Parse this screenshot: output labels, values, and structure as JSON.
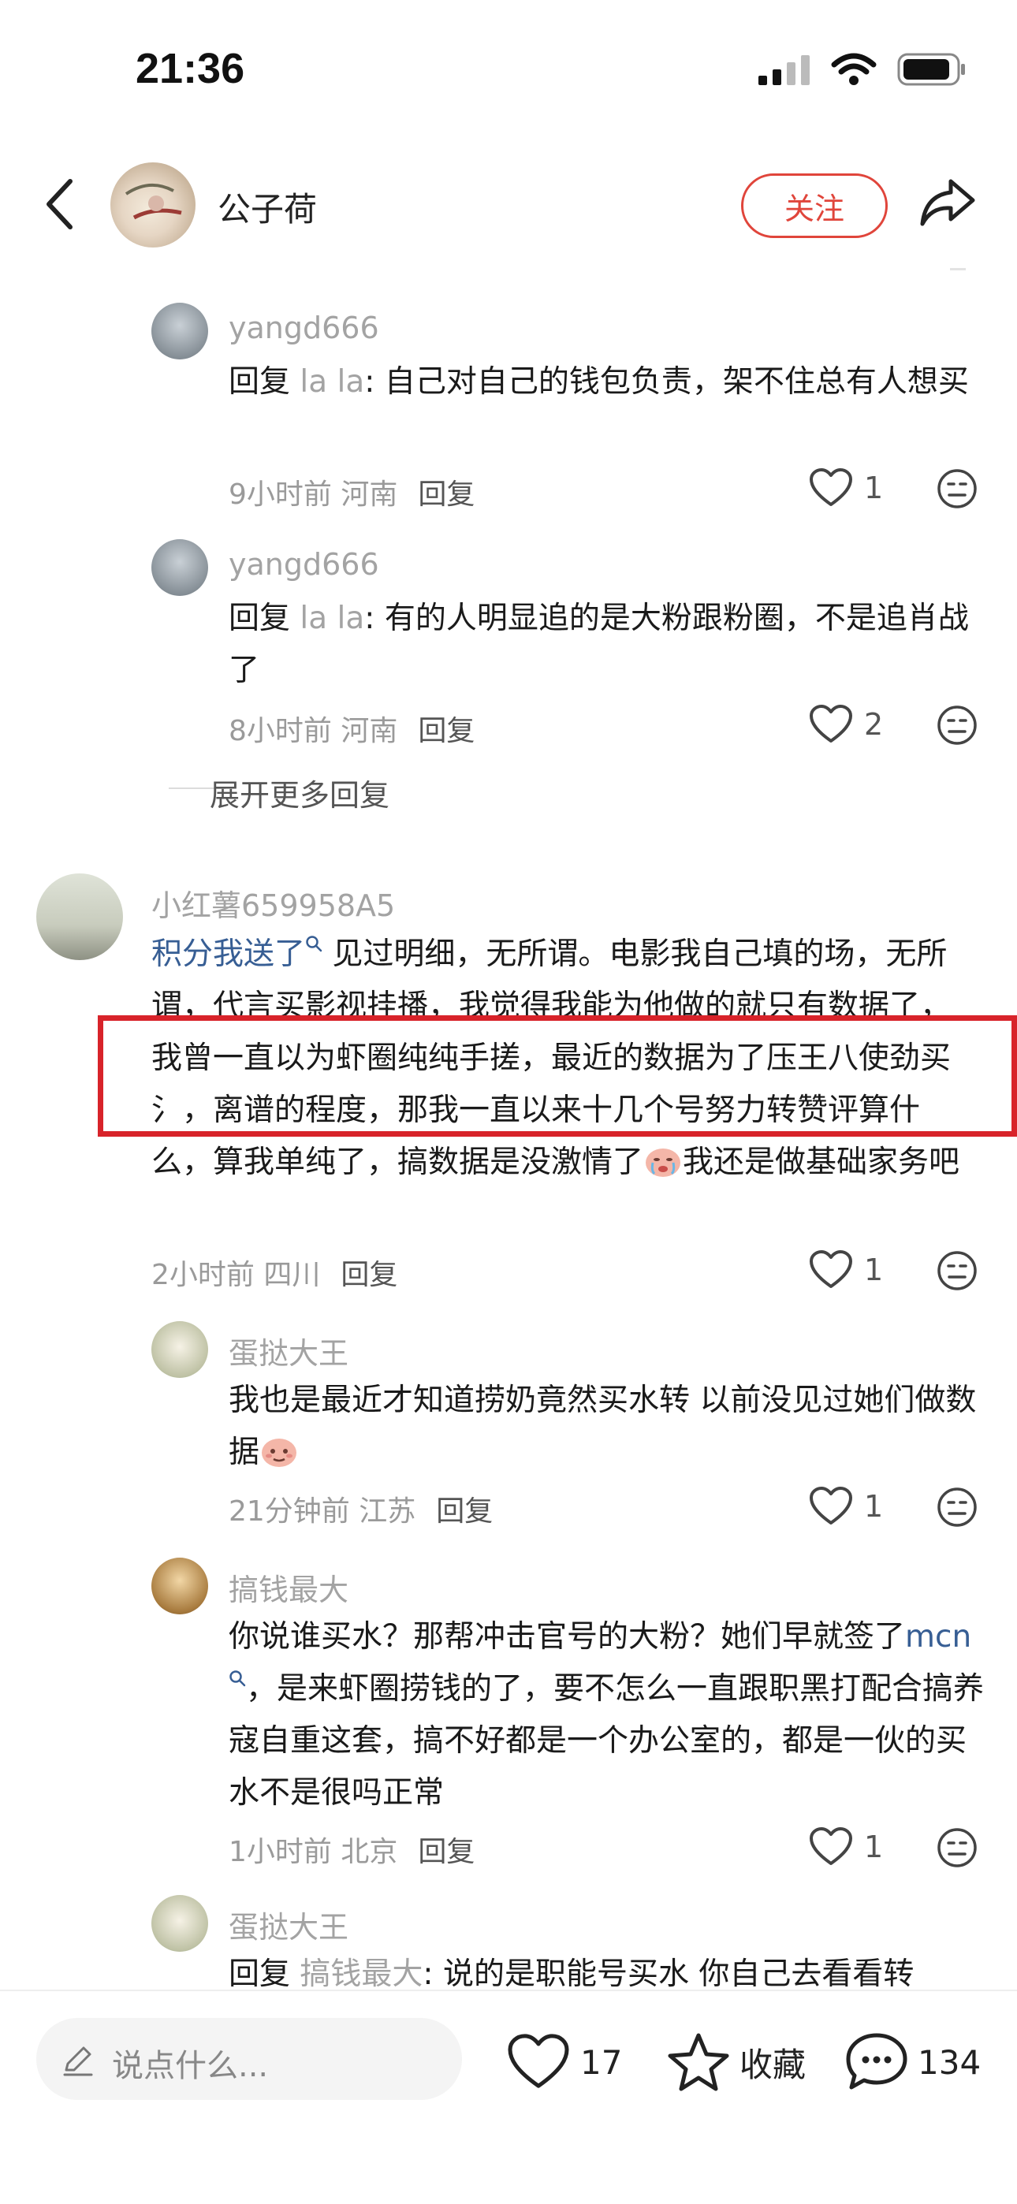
{
  "status_bar": {
    "time": "21:36"
  },
  "header": {
    "author": "公子荷",
    "follow_label": "关注"
  },
  "comments": [
    {
      "user": "yangd666",
      "prefix": "回复 ",
      "reply_to": "la la",
      "text": ": 自己对自己的钱包负责，架不住总有人想买",
      "time": "9小时前",
      "location": "河南",
      "reply_label": "回复",
      "likes": "1"
    },
    {
      "user": "yangd666",
      "prefix": "回复 ",
      "reply_to": "la la",
      "text": ": 有的人明显追的是大粉跟粉圈，不是追肖战了",
      "time": "8小时前",
      "location": "河南",
      "reply_label": "回复",
      "likes": "2"
    },
    {
      "user": "小红薯659958A5",
      "topic": "积分我送了",
      "text": " 见过明细，无所谓。电影我自己填的场，无所谓，代言买影视挂播，我觉得我能为他做的就只有数据了，我曾一直以为虾圈纯纯手搓，最近的数据为了压王八使劲买氵，离谱的程度，那我一直以来十几个号努力转赞评算什么，算我单纯了，搞数据是没激情了",
      "text_after_emoji": "我还是做基础家务吧",
      "time": "2小时前",
      "location": "四川",
      "reply_label": "回复",
      "likes": "1"
    },
    {
      "user": "蛋挞大王",
      "text": "我也是最近才知道捞奶竟然买水转 以前没见过她们做数据",
      "time": "21分钟前",
      "location": "江苏",
      "reply_label": "回复",
      "likes": "1"
    },
    {
      "user": "搞钱最大",
      "text_before_topic": "你说谁买水？那帮冲击官号的大粉？她们早就签了",
      "topic": "mcn",
      "text_after_topic": "，是来虾圈捞钱的了，要不怎么一直跟职黑打配合搞养寇自重这套，搞不好都是一个办公室的，都是一伙的买水不是很吗正常",
      "time": "1小时前",
      "location": "北京",
      "reply_label": "回复",
      "likes": "1"
    },
    {
      "user": "蛋挞大王",
      "prefix": "回复 ",
      "reply_to": "搞钱最大",
      "text": ": 说的是职能号买水 你自己去看看转"
    }
  ],
  "expand_more": "展开更多回复",
  "bottom_bar": {
    "input_placeholder": "说点什么...",
    "likes": "17",
    "collect_label": "收藏",
    "comments": "134"
  },
  "colors": {
    "accent": "#e0453b",
    "highlight_box": "#d8232a",
    "topic_link": "#375e94"
  }
}
